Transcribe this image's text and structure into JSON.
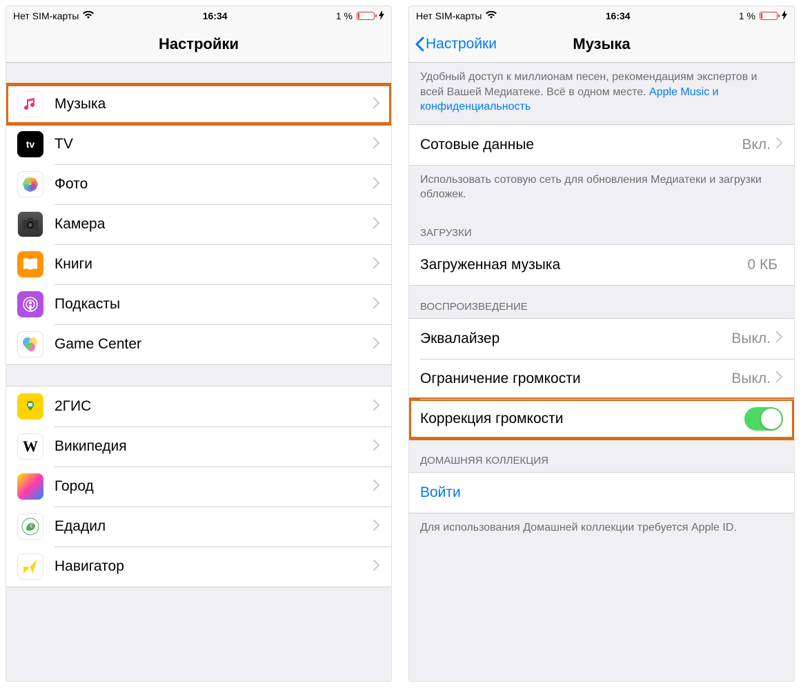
{
  "statusbar": {
    "carrier": "Нет SIM-карты",
    "time": "16:34",
    "battery_pct": "1 %"
  },
  "left": {
    "title": "Настройки",
    "group1": [
      {
        "icon_name": "music-icon",
        "label": "Музыка",
        "highlight": true
      },
      {
        "icon_name": "tv-icon",
        "label": "TV"
      },
      {
        "icon_name": "photos-icon",
        "label": "Фото"
      },
      {
        "icon_name": "camera-icon",
        "label": "Камера"
      },
      {
        "icon_name": "books-icon",
        "label": "Книги"
      },
      {
        "icon_name": "podcasts-icon",
        "label": "Подкасты"
      },
      {
        "icon_name": "gamecenter-icon",
        "label": "Game Center"
      }
    ],
    "group2": [
      {
        "icon_name": "2gis-icon",
        "label": "2ГИС"
      },
      {
        "icon_name": "wikipedia-icon",
        "label": "Википедия"
      },
      {
        "icon_name": "gorod-icon",
        "label": "Город"
      },
      {
        "icon_name": "edadil-icon",
        "label": "Едадил"
      },
      {
        "icon_name": "navigator-icon",
        "label": "Навигатор"
      }
    ]
  },
  "right": {
    "back": "Настройки",
    "title": "Музыка",
    "intro_text": "Удобный доступ к миллионам песен, рекомендациям экспертов и всей Вашей Медиатеке. Всё в одном месте. ",
    "intro_link": "Apple Music и конфиденциальность",
    "cellular": {
      "label": "Сотовые данные",
      "value": "Вкл."
    },
    "cellular_footer": "Использовать сотовую сеть для обновления Медиатеки и загрузки обложек.",
    "downloads_header": "ЗАГРУЗКИ",
    "downloaded": {
      "label": "Загруженная музыка",
      "value": "0 КБ"
    },
    "playback_header": "ВОСПРОИЗВЕДЕНИЕ",
    "eq": {
      "label": "Эквалайзер",
      "value": "Выкл."
    },
    "limit": {
      "label": "Ограничение громкости",
      "value": "Выкл."
    },
    "soundcheck": {
      "label": "Коррекция громкости",
      "on": true
    },
    "home_header": "ДОМАШНЯЯ КОЛЛЕКЦИЯ",
    "signin": "Войти",
    "home_footer": "Для использования Домашней коллекции требуется Apple ID."
  }
}
